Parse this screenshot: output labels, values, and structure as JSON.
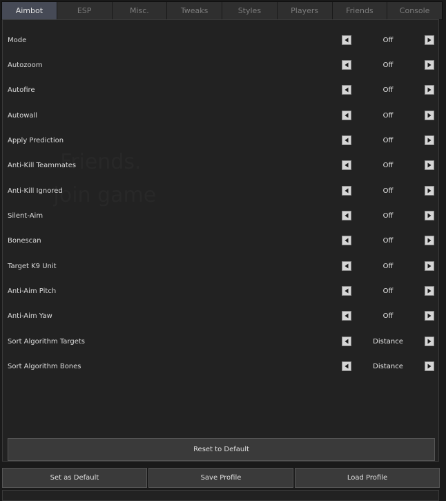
{
  "tabs": [
    {
      "label": "Aimbot",
      "active": true
    },
    {
      "label": "ESP",
      "active": false
    },
    {
      "label": "Misc.",
      "active": false
    },
    {
      "label": "Tweaks",
      "active": false
    },
    {
      "label": "Styles",
      "active": false
    },
    {
      "label": "Players",
      "active": false
    },
    {
      "label": "Friends",
      "active": false
    },
    {
      "label": "Console",
      "active": false
    }
  ],
  "settings": [
    {
      "label": "Mode",
      "value": "Off"
    },
    {
      "label": "Autozoom",
      "value": "Off"
    },
    {
      "label": "Autofire",
      "value": "Off"
    },
    {
      "label": "Autowall",
      "value": "Off"
    },
    {
      "label": "Apply Prediction",
      "value": "Off"
    },
    {
      "label": "Anti-Kill Teammates",
      "value": "Off"
    },
    {
      "label": "Anti-Kill Ignored",
      "value": "Off"
    },
    {
      "label": "Silent-Aim",
      "value": "Off"
    },
    {
      "label": "Bonescan",
      "value": "Off"
    },
    {
      "label": "Target K9 Unit",
      "value": "Off"
    },
    {
      "label": "Anti-Aim Pitch",
      "value": "Off"
    },
    {
      "label": "Anti-Aim Yaw",
      "value": "Off"
    },
    {
      "label": "Sort Algorithm Targets",
      "value": "Distance"
    },
    {
      "label": "Sort Algorithm Bones",
      "value": "Distance"
    }
  ],
  "reset_button": "Reset to Default",
  "bottom_buttons": {
    "set_default": "Set as Default",
    "save_profile": "Save Profile",
    "load_profile": "Load Profile"
  },
  "watermark_text": ". Friends.\n join game",
  "icons": {
    "prev": "left-arrow-icon",
    "next": "right-arrow-icon"
  }
}
